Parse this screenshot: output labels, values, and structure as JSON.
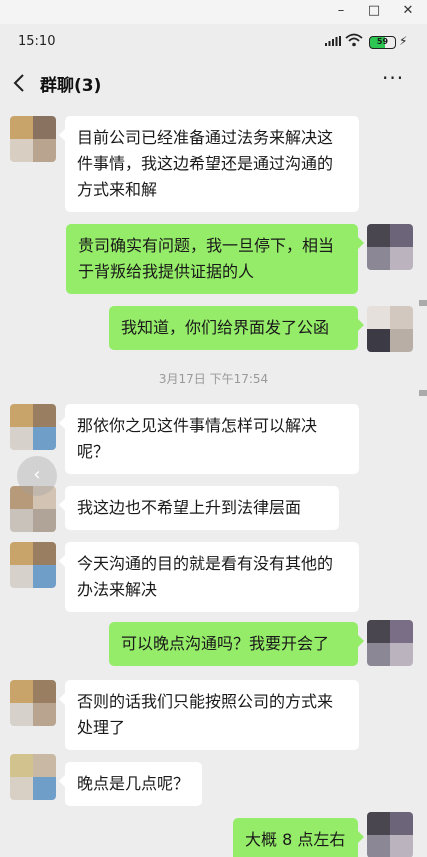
{
  "window": {
    "minimize": "–",
    "maximize": "□",
    "close": "✕"
  },
  "status": {
    "time": "15:10",
    "battery": "59"
  },
  "header": {
    "title": "群聊(3)",
    "more": "···"
  },
  "messages": [
    {
      "text": "目前公司已经准备通过法务来解决这件事情，我这边希望还是通过沟通的方式来和解"
    },
    {
      "text": "贵司确实有问题，我一旦停下，相当于背叛给我提供证据的人"
    },
    {
      "text": "我知道，你们给界面发了公函"
    },
    {
      "text": "那依你之见这件事情怎样可以解决呢？"
    },
    {
      "text": "我这边也不希望上升到法律层面"
    },
    {
      "text": "今天沟通的目的就是看有没有其他的办法来解决"
    },
    {
      "text": "可以晚点沟通吗？我要开会了"
    },
    {
      "text": "否则的话我们只能按照公司的方式来处理了"
    },
    {
      "text": "晚点是几点呢？"
    },
    {
      "text": "大概 8 点左右"
    }
  ],
  "timestamp": "3月17日 下午17:54",
  "float_button": "‹",
  "colors": {
    "background": "#ededed",
    "incoming": "#ffffff",
    "outgoing": "#95ec69"
  }
}
